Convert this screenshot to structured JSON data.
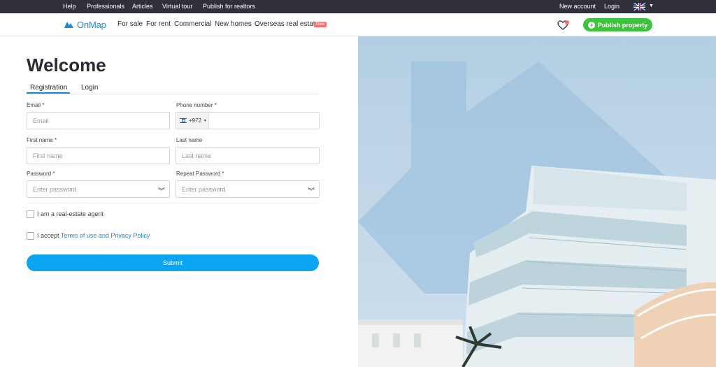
{
  "topbar": {
    "help": "Help",
    "professionals": "Professionals",
    "articles": "Articles",
    "virtual_tour": "Virtual tour",
    "publish_for_realtors": "Publish for realtors",
    "new_account": "New account",
    "login": "Login"
  },
  "header": {
    "logo": "OnMap",
    "nav": {
      "for_sale": "For sale",
      "for_rent": "For rent",
      "commercial": "Commercial",
      "new_homes": "New homes",
      "overseas": "Overseas real estate",
      "new_badge": "New"
    },
    "publish_label": "Publish property"
  },
  "form": {
    "title": "Welcome",
    "tabs": {
      "registration": "Registration",
      "login": "Login"
    },
    "email_label": "Email *",
    "email_placeholder": "Email",
    "phone_label": "Phone number *",
    "phone_prefix": "+972",
    "first_name_label": "First name *",
    "first_name_placeholder": "First name",
    "last_name_label": "Last name",
    "last_name_placeholder": "Last name",
    "password_label": "Password *",
    "password_placeholder": "Enter password",
    "repeat_password_label": "Repeat Password *",
    "repeat_password_placeholder": "Enter password",
    "agent_checkbox": "I am a real-estate agent",
    "accept_prefix": "I accept ",
    "terms_link": "Terms of use and Privacy Policy",
    "submit": "Submit"
  },
  "colors": {
    "accent": "#0aa5f0",
    "brand": "#1a8ad8",
    "publish": "#3cc43c",
    "topbar": "#30303a"
  }
}
